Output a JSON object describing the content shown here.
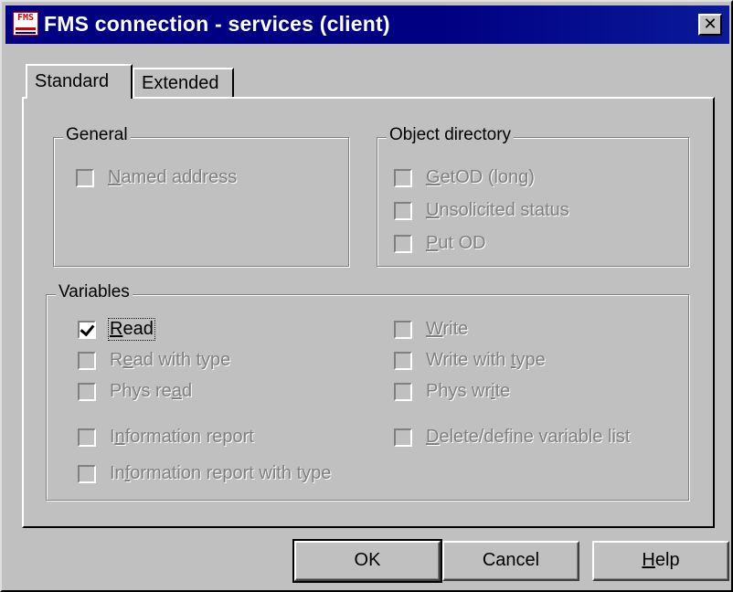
{
  "window": {
    "title": "FMS connection - services (client)",
    "icon_label": "FMS",
    "close_glyph": "✕"
  },
  "tabs": [
    {
      "label": "Standard",
      "active": true
    },
    {
      "label": "Extended",
      "active": false
    }
  ],
  "general": {
    "legend": "General",
    "items": [
      {
        "label": "Named address",
        "checked": false,
        "enabled": false
      }
    ]
  },
  "object_directory": {
    "legend": "Object directory",
    "items": [
      {
        "label": "GetOD (long)",
        "checked": false,
        "enabled": false
      },
      {
        "label": "Unsolicited status",
        "checked": false,
        "enabled": false
      },
      {
        "label": "Put OD",
        "checked": false,
        "enabled": false
      }
    ]
  },
  "variables": {
    "legend": "Variables",
    "left": [
      {
        "label": "Read",
        "checked": true,
        "enabled": true
      },
      {
        "label": "Read with type",
        "checked": false,
        "enabled": false
      },
      {
        "label": "Phys read",
        "checked": false,
        "enabled": false
      },
      {
        "label": "Information report",
        "checked": false,
        "enabled": false
      },
      {
        "label": "Information report with type",
        "checked": false,
        "enabled": false
      }
    ],
    "right": [
      {
        "label": "Write",
        "checked": false,
        "enabled": false
      },
      {
        "label": "Write with type",
        "checked": false,
        "enabled": false
      },
      {
        "label": "Phys write",
        "checked": false,
        "enabled": false
      },
      {
        "label": "Delete/define variable list",
        "checked": false,
        "enabled": false
      }
    ]
  },
  "buttons": {
    "ok": "OK",
    "cancel": "Cancel",
    "help": "Help"
  },
  "colors": {
    "titlebar": "#000082",
    "face": "#c0c0c0",
    "disabled_text": "#808080"
  }
}
